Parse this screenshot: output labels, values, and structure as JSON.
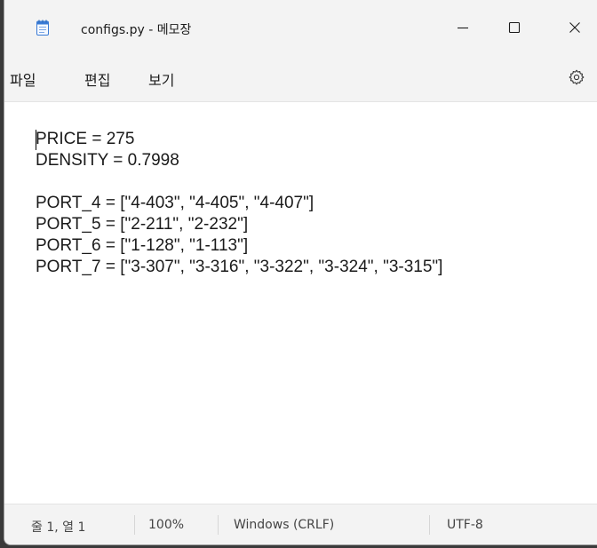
{
  "window": {
    "title": "configs.py - 메모장",
    "buttons": {
      "minimize": "minimize-icon",
      "maximize": "maximize-icon",
      "close": "close-icon"
    }
  },
  "menu": {
    "items": [
      {
        "label": "파일"
      },
      {
        "label": "편집"
      },
      {
        "label": "보기"
      }
    ],
    "settings_icon": "gear-icon"
  },
  "editor": {
    "lines": [
      "PRICE = 275",
      "DENSITY = 0.7998",
      "",
      "PORT_4 = [\"4-403\", \"4-405\", \"4-407\"]",
      "PORT_5 = [\"2-211\", \"2-232\"]",
      "PORT_6 = [\"1-128\", \"1-113\"]",
      "PORT_7 = [\"3-307\", \"3-316\", \"3-322\", \"3-324\", \"3-315\"]"
    ]
  },
  "status": {
    "position": "줄 1, 열 1",
    "zoom": "100%",
    "line_ending": "Windows (CRLF)",
    "encoding": "UTF-8"
  },
  "colors": {
    "chrome": "#f3f3f3",
    "editor_bg": "#ffffff",
    "text": "#1a1a1a",
    "icon_accent": "#2c6bbd"
  }
}
